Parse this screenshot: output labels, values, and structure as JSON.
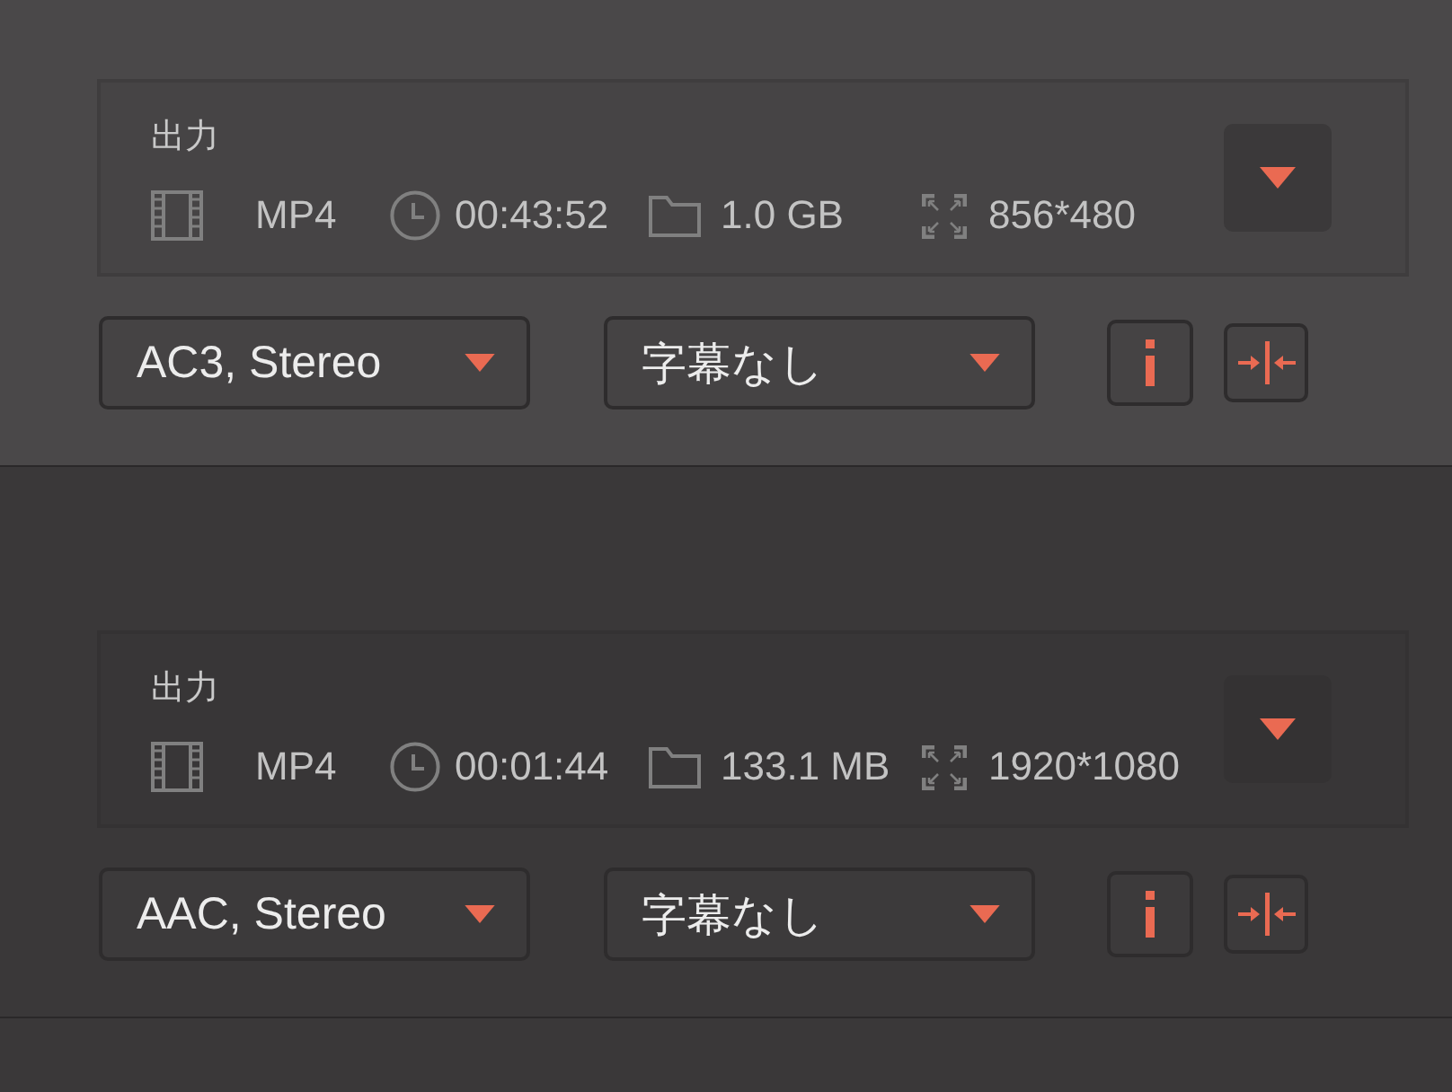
{
  "items": [
    {
      "selected": true,
      "output": {
        "label": "出力",
        "format": "MP4",
        "duration": "00:43:52",
        "size": "1.0 GB",
        "resolution": "856*480"
      },
      "audio": "AC3, Stereo",
      "subtitle": "字幕なし"
    },
    {
      "selected": false,
      "output": {
        "label": "出力",
        "format": "MP4",
        "duration": "00:01:44",
        "size": "133.1 MB",
        "resolution": "1920*1080"
      },
      "audio": "AAC, Stereo",
      "subtitle": "字幕なし"
    }
  ]
}
